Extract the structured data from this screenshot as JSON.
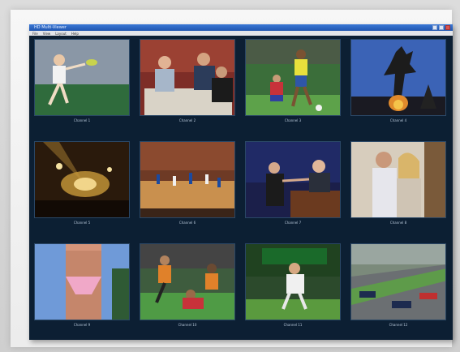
{
  "window": {
    "title": "HD Multi-Viewer",
    "menu": [
      "File",
      "View",
      "Layout",
      "Help"
    ]
  },
  "tiles": [
    {
      "label": "Channel 1",
      "scene": "tennis"
    },
    {
      "label": "Channel 2",
      "scene": "news"
    },
    {
      "label": "Channel 3",
      "scene": "soccer"
    },
    {
      "label": "Channel 4",
      "scene": "statue"
    },
    {
      "label": "Channel 5",
      "scene": "concert"
    },
    {
      "label": "Channel 6",
      "scene": "basketball"
    },
    {
      "label": "Channel 7",
      "scene": "talkshow"
    },
    {
      "label": "Channel 8",
      "scene": "drama"
    },
    {
      "label": "Channel 9",
      "scene": "beach"
    },
    {
      "label": "Channel 10",
      "scene": "football"
    },
    {
      "label": "Channel 11",
      "scene": "golfer"
    },
    {
      "label": "Channel 12",
      "scene": "racing"
    }
  ],
  "colors": {
    "background": "#0c1f33",
    "titlebar": "#2a66c4"
  }
}
